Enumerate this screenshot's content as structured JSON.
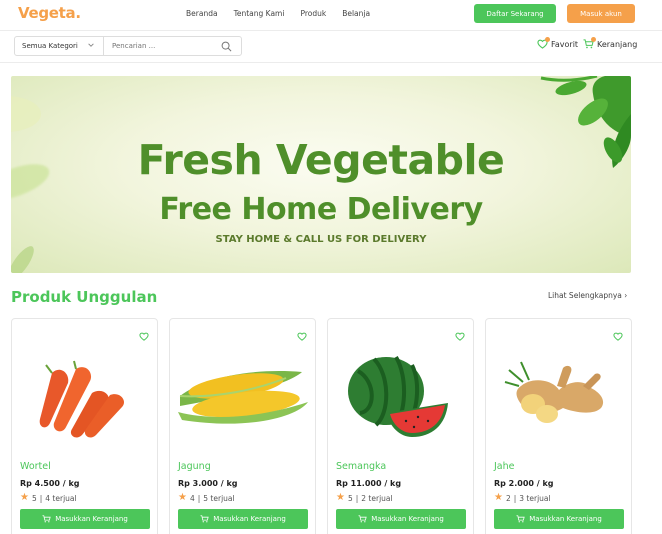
{
  "brand": {
    "logo": "Vegeta.",
    "accent": "#4cc65a",
    "secondary": "#f5a04a"
  },
  "nav": {
    "items": [
      "Beranda",
      "Tentang Kami",
      "Produk",
      "Belanja"
    ]
  },
  "auth": {
    "register": "Daftar Sekarang",
    "login": "Masuk akun"
  },
  "search": {
    "category": "Semua Kategori",
    "placeholder": "Pencarian ..."
  },
  "header_actions": {
    "favorite": "Favorit",
    "cart": "Keranjang"
  },
  "banner": {
    "line1": "Fresh Vegetable",
    "line2": "Free Home Delivery",
    "line3": "STAY HOME & CALL US FOR DELIVERY"
  },
  "section": {
    "title": "Produk Unggulan",
    "see_more": "Lihat Selengkapnya ›"
  },
  "products": [
    {
      "name": "Wortel",
      "price": "Rp 4.500 / kg",
      "rating": "5",
      "sold": "4 terjual",
      "button": "Masukkan Keranjang",
      "icon": "carrot-image"
    },
    {
      "name": "Jagung",
      "price": "Rp 3.000 / kg",
      "rating": "4",
      "sold": "5 terjual",
      "button": "Masukkan Keranjang",
      "icon": "corn-image"
    },
    {
      "name": "Semangka",
      "price": "Rp 11.000 / kg",
      "rating": "5",
      "sold": "2 terjual",
      "button": "Masukkan Keranjang",
      "icon": "watermelon-image"
    },
    {
      "name": "Jahe",
      "price": "Rp 2.000 / kg",
      "rating": "2",
      "sold": "3 terjual",
      "button": "Masukkan Keranjang",
      "icon": "ginger-image"
    }
  ]
}
